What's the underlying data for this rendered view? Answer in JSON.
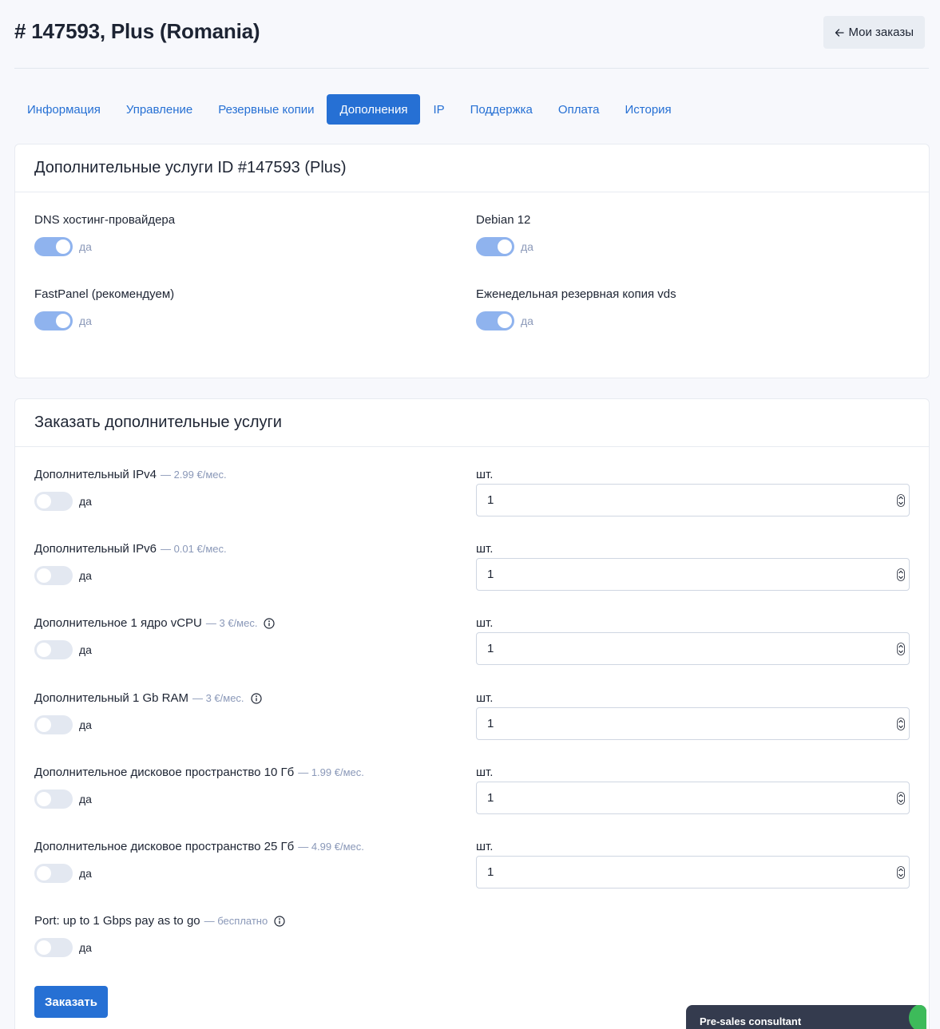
{
  "header": {
    "title": "# 147593, Plus (Romania)",
    "back_label": "Мои заказы"
  },
  "tabs": [
    {
      "label": "Информация",
      "active": false
    },
    {
      "label": "Управление",
      "active": false
    },
    {
      "label": "Резервные копии",
      "active": false
    },
    {
      "label": "Дополнения",
      "active": true
    },
    {
      "label": "IP",
      "active": false
    },
    {
      "label": "Поддержка",
      "active": false
    },
    {
      "label": "Оплата",
      "active": false
    },
    {
      "label": "История",
      "active": false
    }
  ],
  "current_services": {
    "title": "Дополнительные услуги ID #147593 (Plus)",
    "items": [
      {
        "label": "DNS хостинг-провайдера",
        "toggle_label": "да",
        "enabled": true
      },
      {
        "label": "Debian 12",
        "toggle_label": "да",
        "enabled": true
      },
      {
        "label": "FastPanel (рекомендуем)",
        "toggle_label": "да",
        "enabled": true
      },
      {
        "label": "Еженедельная резервная копия vds",
        "toggle_label": "да",
        "enabled": true
      }
    ]
  },
  "order_services": {
    "title": "Заказать дополнительные услуги",
    "quantity_label": "шт.",
    "items": [
      {
        "label": "Дополнительный IPv4",
        "price": "— 2.99 €/мес.",
        "info": false,
        "toggle_label": "да",
        "enabled": false,
        "quantity": "1"
      },
      {
        "label": "Дополнительный IPv6",
        "price": "— 0.01 €/мес.",
        "info": false,
        "toggle_label": "да",
        "enabled": false,
        "quantity": "1"
      },
      {
        "label": "Дополнительное 1 ядро vCPU",
        "price": "— 3 €/мес.",
        "info": true,
        "toggle_label": "да",
        "enabled": false,
        "quantity": "1"
      },
      {
        "label": "Дополнительный 1 Gb RAM",
        "price": "— 3 €/мес.",
        "info": true,
        "toggle_label": "да",
        "enabled": false,
        "quantity": "1"
      },
      {
        "label": "Дополнительное дисковое пространство 10 Гб",
        "price": "— 1.99 €/мес.",
        "info": false,
        "toggle_label": "да",
        "enabled": false,
        "quantity": "1"
      },
      {
        "label": "Дополнительное дисковое пространство 25 Гб",
        "price": "— 4.99 €/мес.",
        "info": false,
        "toggle_label": "да",
        "enabled": false,
        "quantity": "1"
      },
      {
        "label": "Port: up to 1 Gbps pay as to go",
        "price": "— бесплатно",
        "info": true,
        "toggle_label": "да",
        "enabled": false
      }
    ],
    "submit_label": "Заказать"
  },
  "chat_widget": {
    "label": "Pre-sales consultant"
  },
  "colors": {
    "accent": "#2670d4",
    "toggle_on": "#8fb3ee",
    "toggle_off": "#e3e8f1",
    "muted": "#8a98b8",
    "chat_bg": "#343b4e",
    "chat_dot": "#3dbb5a"
  },
  "icons": {
    "back": "arrow-left-icon",
    "info": "info-icon",
    "spinner": "spinner-arrows-icon"
  }
}
